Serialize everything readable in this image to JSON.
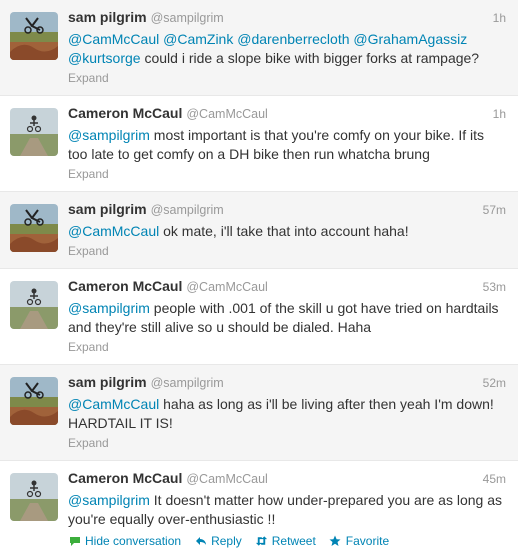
{
  "tweets": [
    {
      "name": "sam pilgrim",
      "handle": "@sampilgrim",
      "time": "1h",
      "avatar": "sam-avatar",
      "mentions": [
        "@CamMcCaul",
        "@CamZink",
        "@darenberrecloth",
        "@GrahamAgassiz",
        "@kurtsorge"
      ],
      "text": "could i ride a slope bike with bigger forks at rampage?",
      "expand": "Expand"
    },
    {
      "name": "Cameron McCaul",
      "handle": "@CamMcCaul",
      "time": "1h",
      "avatar": "cam-avatar",
      "mentions": [
        "@sampilgrim"
      ],
      "text": "most important is that you're comfy on your bike. If its too late to get comfy on a DH bike then run whatcha brung",
      "expand": "Expand"
    },
    {
      "name": "sam pilgrim",
      "handle": "@sampilgrim",
      "time": "57m",
      "avatar": "sam-avatar",
      "mentions": [
        "@CamMcCaul"
      ],
      "text": "ok mate, i'll take that into account haha!",
      "expand": "Expand"
    },
    {
      "name": "Cameron McCaul",
      "handle": "@CamMcCaul",
      "time": "53m",
      "avatar": "cam-avatar",
      "mentions": [
        "@sampilgrim"
      ],
      "text": "people with .001 of the skill u got have tried on hardtails and they're still alive so u should be dialed. Haha",
      "expand": "Expand"
    },
    {
      "name": "sam pilgrim",
      "handle": "@sampilgrim",
      "time": "52m",
      "avatar": "sam-avatar",
      "mentions": [
        "@CamMcCaul"
      ],
      "text": "haha as long as i'll be living after then yeah I'm down! HARDTAIL IT IS!",
      "expand": "Expand"
    },
    {
      "name": "Cameron McCaul",
      "handle": "@CamMcCaul",
      "time": "45m",
      "avatar": "cam-avatar",
      "mentions": [
        "@sampilgrim"
      ],
      "text": "It doesn't matter how under-prepared you are as long as you're equally over-enthusiastic !!",
      "actions": {
        "hide": "Hide conversation",
        "reply": "Reply",
        "retweet": "Retweet",
        "favorite": "Favorite"
      }
    }
  ],
  "colors": {
    "link": "#0084b4",
    "meta": "#999999",
    "text": "#333333",
    "hide_icon": "#3cae3c",
    "alt_background": "#f5f5f5"
  }
}
